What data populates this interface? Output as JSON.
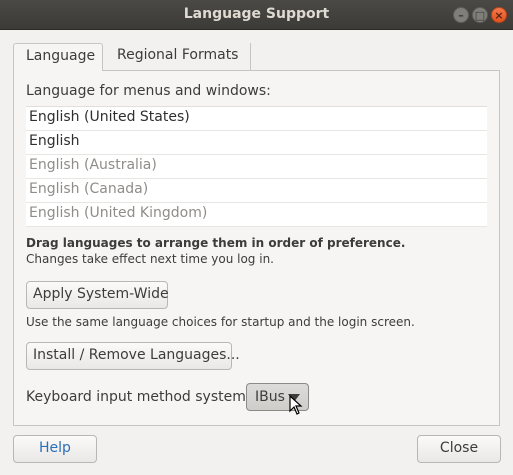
{
  "window": {
    "title": "Language Support",
    "controls": {
      "minimize": "–",
      "maximize": "□",
      "close": "×"
    }
  },
  "tabs": [
    {
      "label": "Language",
      "active": true
    },
    {
      "label": "Regional Formats",
      "active": false
    }
  ],
  "language": {
    "heading": "Language for menus and windows:",
    "items": [
      {
        "label": "English (United States)",
        "enabled": true
      },
      {
        "label": "English",
        "enabled": true
      },
      {
        "label": "English (Australia)",
        "enabled": false
      },
      {
        "label": "English (Canada)",
        "enabled": false
      },
      {
        "label": "English (United Kingdom)",
        "enabled": false
      }
    ],
    "drag_hint": "Drag languages to arrange them in order of preference.",
    "change_hint": "Changes take effect next time you log in.",
    "apply_button": "Apply System-Wide",
    "apply_hint": "Use the same language choices for startup and the login screen.",
    "install_button": "Install / Remove Languages...",
    "keyboard_label": "Keyboard input method system:",
    "keyboard_value": "IBus"
  },
  "footer": {
    "help_button": "Help",
    "close_button": "Close"
  },
  "colors": {
    "titlebar": "#3c3b37",
    "close_button": "#e0531f",
    "help_text": "#2a6fb8"
  }
}
